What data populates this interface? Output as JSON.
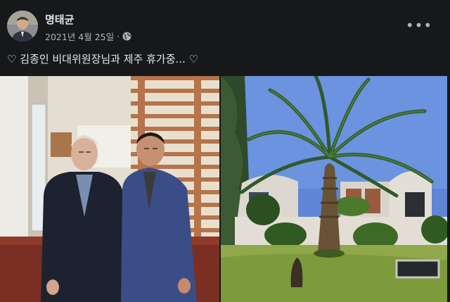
{
  "post": {
    "author": "명태균",
    "date": "2021년 4월 25일",
    "separator": "·",
    "privacy_icon": "globe-icon",
    "more_icon": "more-options-icon",
    "more_label": "•••",
    "caption": "♡ 김종인 비대위원장님과 제주 휴가중...  ♡"
  },
  "photos": [
    {
      "name": "two-men-indoor-photo"
    },
    {
      "name": "palm-tree-house-photo"
    }
  ],
  "colors": {
    "background": "#17181a",
    "text_primary": "#e4e6eb",
    "text_secondary": "#b0b3b8"
  }
}
